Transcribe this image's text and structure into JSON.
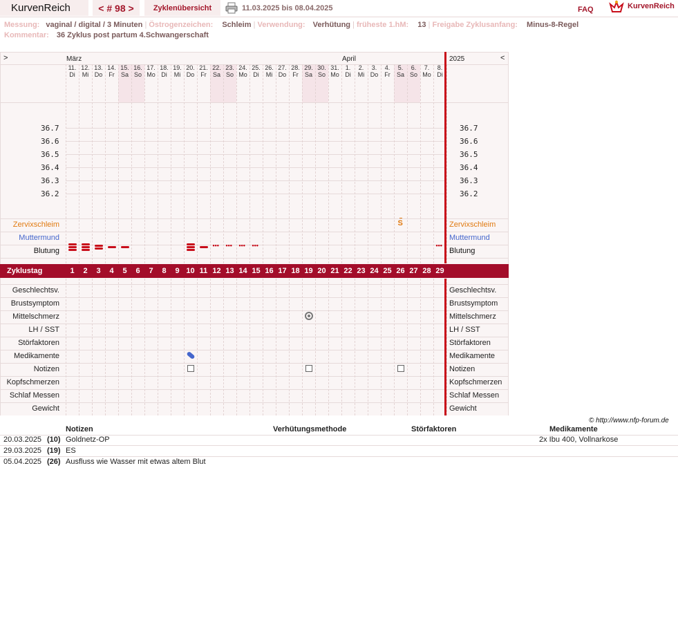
{
  "topbar": {
    "brand": "KurvenReich",
    "cycle": "< # 98 >",
    "overview": "Zyklenübersicht",
    "date_range": "11.03.2025 bis 08.04.2025",
    "faq": "FAQ",
    "logo_text": "KurvenReich"
  },
  "info": {
    "messung_label": "Messung:",
    "messung_value": "vaginal / digital / 3 Minuten",
    "oestrogen_label": "Östrogenzeichen:",
    "oestrogen_value": "Schleim",
    "verwendung_label": "Verwendung:",
    "verwendung_value": "Verhütung",
    "hm_label": "früheste 1.hM:",
    "hm_value": "13",
    "freigabe_label": "Freigabe Zyklusanfang:",
    "freigabe_value": "Minus-8-Regel",
    "kommentar_label": "Kommentar:",
    "kommentar_value": "36 Zyklus post partum 4.Schwangerschaft"
  },
  "chart": {
    "nav_left": ">",
    "nav_right": "<",
    "month1": "März",
    "month2": "April",
    "year": "2025",
    "days": [
      {
        "d": "11.",
        "w": "Di"
      },
      {
        "d": "12.",
        "w": "Mi"
      },
      {
        "d": "13.",
        "w": "Do"
      },
      {
        "d": "14.",
        "w": "Fr"
      },
      {
        "d": "15.",
        "w": "Sa"
      },
      {
        "d": "16.",
        "w": "So"
      },
      {
        "d": "17.",
        "w": "Mo"
      },
      {
        "d": "18.",
        "w": "Di"
      },
      {
        "d": "19.",
        "w": "Mi"
      },
      {
        "d": "20.",
        "w": "Do"
      },
      {
        "d": "21.",
        "w": "Fr"
      },
      {
        "d": "22.",
        "w": "Sa"
      },
      {
        "d": "23.",
        "w": "So"
      },
      {
        "d": "24.",
        "w": "Mo"
      },
      {
        "d": "25.",
        "w": "Di"
      },
      {
        "d": "26.",
        "w": "Mi"
      },
      {
        "d": "27.",
        "w": "Do"
      },
      {
        "d": "28.",
        "w": "Fr"
      },
      {
        "d": "29.",
        "w": "Sa"
      },
      {
        "d": "30.",
        "w": "So"
      },
      {
        "d": "31.",
        "w": "Mo"
      },
      {
        "d": "1.",
        "w": "Di"
      },
      {
        "d": "2.",
        "w": "Mi"
      },
      {
        "d": "3.",
        "w": "Do"
      },
      {
        "d": "4.",
        "w": "Fr"
      },
      {
        "d": "5.",
        "w": "Sa"
      },
      {
        "d": "6.",
        "w": "So"
      },
      {
        "d": "7.",
        "w": "Mo"
      },
      {
        "d": "8.",
        "w": "Di"
      }
    ],
    "temps": [
      "36.7",
      "36.6",
      "36.5",
      "36.4",
      "36.3",
      "36.2"
    ],
    "rows_top": [
      "Zervixschleim",
      "Muttermund",
      "Blutung"
    ],
    "zyklustag_label": "Zyklustag",
    "rows_bottom": [
      "Geschlechtsv.",
      "Brustsymptom",
      "Mittelschmerz",
      "LH / SST",
      "Störfaktoren",
      "Medikamente",
      "Notizen",
      "Kopfschmerzen",
      "Schlaf Messen",
      "Gewicht"
    ],
    "zervix_mark": "S",
    "bleeding": [
      3,
      3,
      2,
      1,
      1,
      0,
      0,
      0,
      0,
      3,
      1,
      "s",
      "s",
      "s",
      "s",
      0,
      0,
      0,
      0,
      0,
      0,
      0,
      0,
      0,
      0,
      0,
      0,
      0,
      "s"
    ],
    "colors": {
      "accent": "#a30d2a",
      "zervix": "#e07a10",
      "muttermund": "#4466cc"
    }
  },
  "copyright": "© http://www.nfp-forum.de",
  "list": {
    "headers": {
      "notizen": "Notizen",
      "verhuetung": "Verhütungsmethode",
      "stoer": "Störfaktoren",
      "medikamente": "Medikamente"
    },
    "rows": [
      {
        "date": "20.03.2025",
        "day": "(10)",
        "note": "Goldnetz-OP",
        "med": "2x Ibu 400, Vollnarkose"
      },
      {
        "date": "29.03.2025",
        "day": "(19)",
        "note": "ES",
        "med": ""
      },
      {
        "date": "05.04.2025",
        "day": "(26)",
        "note": "Ausfluss wie Wasser mit etwas altem Blut",
        "med": ""
      }
    ]
  }
}
